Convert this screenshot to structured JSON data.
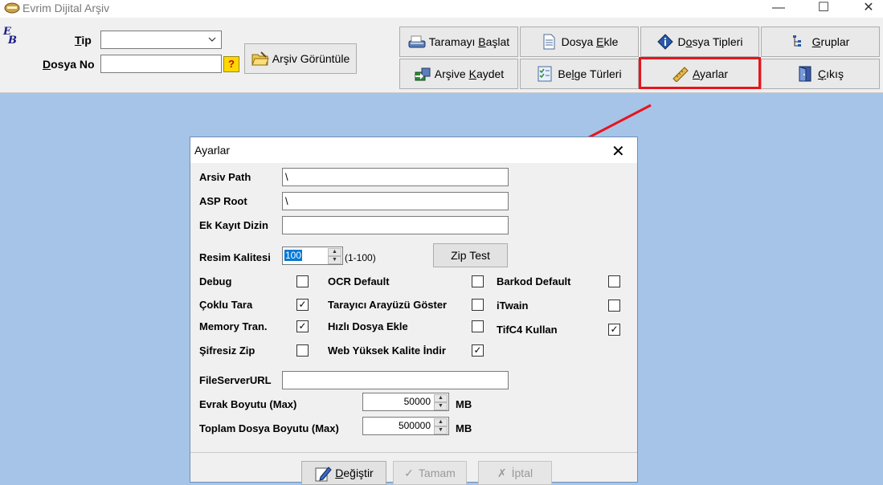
{
  "window": {
    "title": "Evrim Dijital Arşiv",
    "minimize": "—",
    "maximize": "☐",
    "close": "✕"
  },
  "logo": {
    "line1": "E",
    "line2": "B"
  },
  "filters": {
    "tip_label_pre": "",
    "tip_label_key": "T",
    "tip_label_post": "ip",
    "tip_value": "",
    "dosyano_label_key": "D",
    "dosyano_label_post": "osya No",
    "dosyano_value": "",
    "help": "?"
  },
  "arsiv_button": {
    "pre": "Arşiv Görüntüle"
  },
  "toolbar": {
    "buttons": [
      {
        "pre": "Taramayı ",
        "key": "B",
        "post": "aşlat"
      },
      {
        "pre": "Dosya ",
        "key": "E",
        "post": "kle"
      },
      {
        "pre": "D",
        "key": "o",
        "post": "sya Tipleri"
      },
      {
        "pre": "",
        "key": "G",
        "post": "ruplar"
      },
      {
        "pre": "Arşive ",
        "key": "K",
        "post": "aydet"
      },
      {
        "pre": "Be",
        "key": "l",
        "post": "ge Türleri"
      },
      {
        "pre": "",
        "key": "A",
        "post": "yarlar"
      },
      {
        "pre": "",
        "key": "Ç",
        "post": "ıkış"
      }
    ]
  },
  "dialog": {
    "title": "Ayarlar",
    "close": "✕",
    "fields": {
      "arsiv_path_label": "Arsiv Path",
      "arsiv_path_value": "\\",
      "asp_root_label": "ASP Root",
      "asp_root_value": "\\",
      "ek_kayit_label": "Ek Kayıt Dizin",
      "ek_kayit_value": "",
      "resim_kalitesi_label": "Resim Kalitesi",
      "resim_kalitesi_value": "100",
      "resim_kalitesi_range": "(1-100)",
      "zip_test": "Zip Test",
      "fileserver_label": "FileServerURL",
      "fileserver_value": "",
      "evrak_label": "Evrak Boyutu (Max)",
      "evrak_value": "50000",
      "evrak_unit": "MB",
      "toplam_label": "Toplam Dosya Boyutu (Max)",
      "toplam_value": "500000",
      "toplam_unit": "MB"
    },
    "checkboxes": [
      {
        "label": "Debug",
        "checked": false
      },
      {
        "label": "Çoklu Tara",
        "checked": true
      },
      {
        "label": "Memory Tran.",
        "checked": true
      },
      {
        "label": "Şifresiz Zip",
        "checked": false
      },
      {
        "label": "OCR Default",
        "checked": false
      },
      {
        "label": "Tarayıcı Arayüzü Göster",
        "checked": false
      },
      {
        "label": "Hızlı Dosya Ekle",
        "checked": false
      },
      {
        "label": "Web Yüksek Kalite İndir",
        "checked": true
      },
      {
        "label": "Barkod Default",
        "checked": false
      },
      {
        "label": "iTwain",
        "checked": false
      },
      {
        "label": "TifC4 Kullan",
        "checked": true
      }
    ],
    "footer": {
      "degistir_key": "D",
      "degistir_post": "eğiştir",
      "tamam": "Tamam",
      "iptal": "İptal"
    }
  },
  "colors": {
    "highlight": "#e8141c",
    "arrow": "#e8141c",
    "background": "#a6c4e8"
  }
}
